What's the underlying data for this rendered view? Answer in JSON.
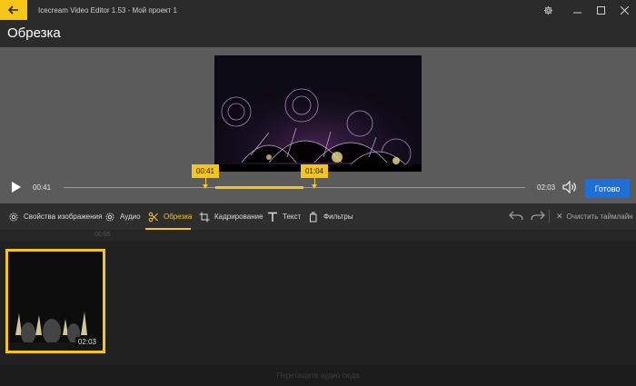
{
  "window": {
    "title": "Icecream Video Editor 1.53  -  Мой проект 1",
    "icons": {
      "back": "arrow-left-icon",
      "settings": "gear-icon",
      "minimize": "minimize-icon",
      "maximize": "maximize-icon",
      "close": "close-icon"
    }
  },
  "header": {
    "title": "Обрезка"
  },
  "player": {
    "current_time": "00:41",
    "duration": "02:03",
    "trim_start": "00:41",
    "trim_end": "01:04",
    "done_label": "Готово"
  },
  "toolbar": {
    "items": [
      {
        "label": "Свойства изображения",
        "icon": "gear-icon"
      },
      {
        "label": "Аудио",
        "icon": "gear-icon"
      },
      {
        "label": "Обрезка",
        "icon": "scissors-icon",
        "active": true
      },
      {
        "label": "Кадрирование",
        "icon": "crop-icon"
      },
      {
        "label": "Текст",
        "icon": "text-icon"
      },
      {
        "label": "Фильтры",
        "icon": "filter-icon"
      }
    ],
    "clear_label": "Очистить таймлайн"
  },
  "timeline": {
    "clip_duration": "02:03",
    "hint": "Перетащите аудио сюда"
  },
  "colors": {
    "accent": "#f5c518",
    "primary_button": "#1e6fd8",
    "background": "#1f1f1f"
  }
}
